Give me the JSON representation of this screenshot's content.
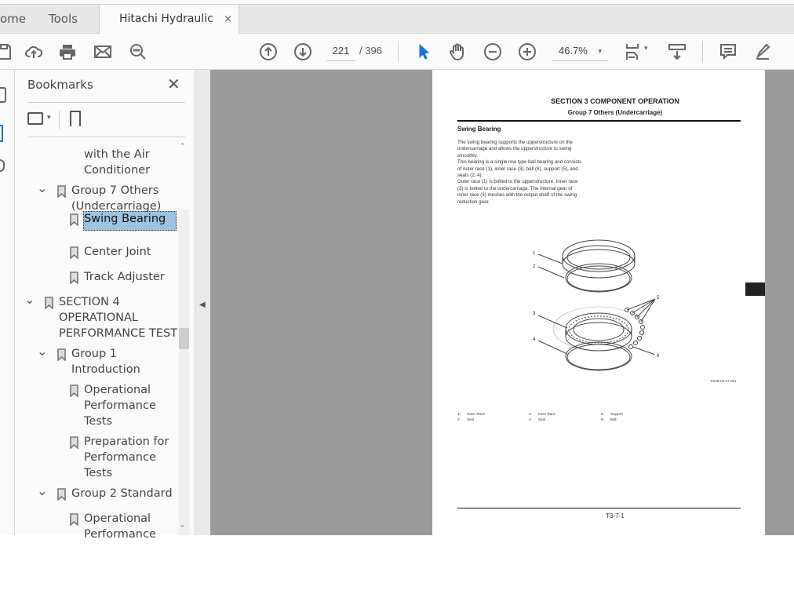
{
  "tabs": {
    "home": "ome",
    "tools": "Tools",
    "document": "Hitachi Hydraulic Ex...",
    "close": "×"
  },
  "toolbar": {
    "page_current": "221",
    "page_total": "/  396",
    "zoom": "46.7%",
    "zoom_caret": "▾"
  },
  "panel": {
    "title": "Bookmarks",
    "close": "✕"
  },
  "bookmarks": [
    {
      "lines": "with the Air\nConditioner",
      "level": 3
    },
    {
      "lines": "Group 7 Others\n(Undercarriage)",
      "level": 2,
      "expanded": true
    },
    {
      "lines": "Swing Bearing",
      "level": 3,
      "selected": true
    },
    {
      "lines": "Center Joint",
      "level": 3
    },
    {
      "lines": "Track Adjuster",
      "level": 3
    },
    {
      "lines": "SECTION 4\nOPERATIONAL\nPERFORMANCE TEST",
      "level": 1,
      "expanded": true
    },
    {
      "lines": "Group 1\nIntroduction",
      "level": 2,
      "expanded": true
    },
    {
      "lines": "Operational\nPerformance\nTests",
      "level": 3
    },
    {
      "lines": "Preparation for\nPerformance\nTests",
      "level": 3
    },
    {
      "lines": "Group 2 Standard",
      "level": 2,
      "expanded": true
    },
    {
      "lines": "Operational\nPerformance",
      "level": 3
    }
  ],
  "document": {
    "section": "SECTION 3 COMPONENT OPERATION",
    "group": "Group 7 Others (Undercarriage)",
    "heading": "Swing Bearing",
    "body": "The swing bearing supports the upperstructure on the\nundercarriage and allows the upperstructure to swing\nsmoothly.\nThis bearing is a single row type ball bearing and consists\nof outer race (1), inner race (3), ball (6), support (5), and\nseals (2, 4).\nOuter race (1) is bolted to the upperstructure. Inner race\n(3) is bolted to the undercarriage. The internal gear of\ninner race (3) meshes with the output shaft of the swing\nreduction gear.",
    "figure_id": "TADB-03-07-001",
    "callouts": [
      "1",
      "2",
      "3",
      "4",
      "5",
      "6"
    ],
    "legend": [
      {
        "num": "1-",
        "label": "Outer Race"
      },
      {
        "num": "2-",
        "label": "Seal"
      },
      {
        "num": "3-",
        "label": "Inner Race"
      },
      {
        "num": "4-",
        "label": "Seal"
      },
      {
        "num": "5-",
        "label": "Support"
      },
      {
        "num": "6-",
        "label": "Ball"
      }
    ],
    "footer": "T3-7-1"
  }
}
